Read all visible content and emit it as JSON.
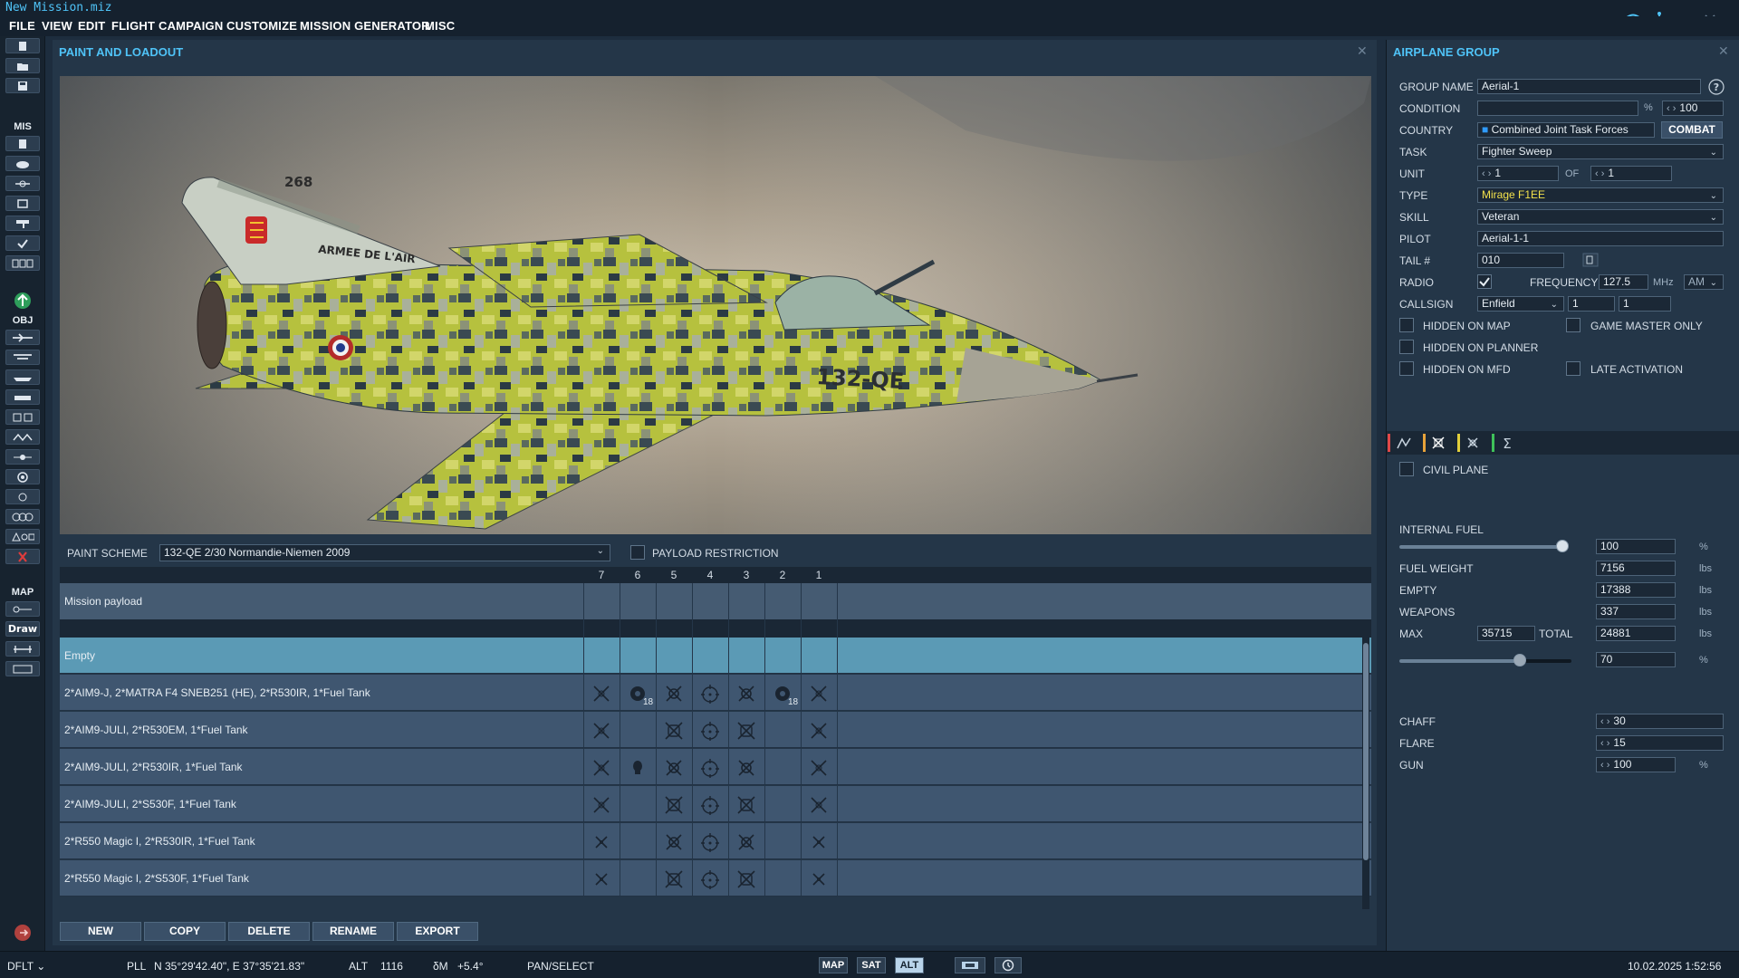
{
  "window": {
    "title": "New Mission.miz"
  },
  "menu": [
    "FILE",
    "VIEW",
    "EDIT",
    "FLIGHT",
    "CAMPAIGN",
    "CUSTOMIZE",
    "MISSION GENERATOR",
    "MISC"
  ],
  "toolbar": {
    "mis_label": "MIS",
    "obj_label": "OBJ",
    "map_label": "MAP",
    "draw_label": "Draw"
  },
  "paint": {
    "title": "PAINT AND LOADOUT",
    "aircraft_tail_text": "268",
    "aircraft_side_text": "ARMEE DE L'AIR",
    "aircraft_code": "132-QE",
    "scheme_label": "PAINT SCHEME",
    "scheme_value": "132-QE 2/30 Normandie-Niemen 2009",
    "restriction_label": "PAYLOAD RESTRICTION",
    "restriction_checked": false,
    "pylons": [
      "7",
      "6",
      "5",
      "4",
      "3",
      "2",
      "1"
    ],
    "mission_payload_label": "Mission payload",
    "rows": [
      {
        "label": "Empty",
        "selected": true,
        "cells": [
          "",
          "",
          "",
          "",
          "",
          "",
          ""
        ]
      },
      {
        "label": "2*AIM9-J, 2*MATRA F4 SNEB251 (HE), 2*R530IR, 1*Fuel Tank",
        "cells": [
          "x",
          "rocket",
          "r530",
          "tank",
          "r530",
          "rocket",
          "x"
        ],
        "rocket_count": "18"
      },
      {
        "label": "2*AIM9-JULI, 2*R530EM, 1*Fuel Tank",
        "cells": [
          "x",
          "",
          "r530em",
          "tank",
          "r530em",
          "",
          "x"
        ]
      },
      {
        "label": "2*AIM9-JULI, 2*R530IR, 1*Fuel Tank",
        "cells": [
          "x",
          "skull",
          "r530",
          "tank",
          "r530",
          "",
          "x"
        ]
      },
      {
        "label": "2*AIM9-JULI, 2*S530F, 1*Fuel Tank",
        "cells": [
          "x",
          "",
          "r530em",
          "tank",
          "r530em",
          "",
          "x"
        ]
      },
      {
        "label": "2*R550 Magic I, 2*R530IR, 1*Fuel Tank",
        "cells": [
          "xs",
          "",
          "r530",
          "tank",
          "r530",
          "",
          "xs"
        ]
      },
      {
        "label": "2*R550 Magic I, 2*S530F, 1*Fuel Tank",
        "cells": [
          "xs",
          "",
          "r530em",
          "tank",
          "r530em",
          "",
          "xs"
        ]
      }
    ],
    "buttons": [
      "NEW",
      "COPY",
      "DELETE",
      "RENAME",
      "EXPORT"
    ]
  },
  "group": {
    "title": "AIRPLANE GROUP",
    "group_name_label": "GROUP NAME",
    "group_name": "Aerial-1",
    "condition_label": "CONDITION",
    "condition_unit": "%",
    "condition_value": "100",
    "country_label": "COUNTRY",
    "country": "Combined Joint Task Forces",
    "combat_label": "COMBAT",
    "task_label": "TASK",
    "task": "Fighter Sweep",
    "unit_label": "UNIT",
    "unit_value": "1",
    "of_label": "OF",
    "of_value": "1",
    "type_label": "TYPE",
    "type": "Mirage F1EE",
    "skill_label": "SKILL",
    "skill": "Veteran",
    "pilot_label": "PILOT",
    "pilot": "Aerial-1-1",
    "tail_label": "TAIL #",
    "tail": "010",
    "radio_label": "RADIO",
    "radio_checked": true,
    "frequency_label": "FREQUENCY",
    "frequency": "127.5",
    "freq_unit": "MHz",
    "modulation": "AM",
    "callsign_label": "CALLSIGN",
    "callsign": "Enfield",
    "callsign_n1": "1",
    "callsign_n2": "1",
    "hidden_map_label": "HIDDEN ON MAP",
    "game_master_label": "GAME MASTER ONLY",
    "hidden_planner_label": "HIDDEN ON PLANNER",
    "hidden_mfd_label": "HIDDEN ON MFD",
    "late_activation_label": "LATE ACTIVATION",
    "civil_plane_label": "CIVIL PLANE",
    "internal_fuel_label": "INTERNAL FUEL",
    "internal_fuel": "100",
    "internal_fuel_unit": "%",
    "internal_fuel_fraction": 1.0,
    "fuel_weight_label": "FUEL WEIGHT",
    "fuel_weight": "7156",
    "empty_label": "EMPTY",
    "empty": "17388",
    "weapons_label": "WEAPONS",
    "weapons": "337",
    "max_label": "MAX",
    "max": "35715",
    "total_label": "TOTAL",
    "total": "24881",
    "weight_unit": "lbs",
    "total_percent": "70",
    "total_percent_unit": "%",
    "total_percent_fraction": 0.7,
    "chaff_label": "CHAFF",
    "chaff": "30",
    "flare_label": "FLARE",
    "flare": "15",
    "gun_label": "GUN",
    "gun": "100",
    "gun_unit": "%",
    "tab_colors": [
      "#e04848",
      "#e8a33a",
      "#e2cf3b",
      "#3fc25a"
    ]
  },
  "status": {
    "profile": "DFLT",
    "coord_mode": "PLL",
    "coords": "N 35°29'42.40\", E 37°35'21.83\"",
    "alt_label": "ALT",
    "alt": "1116",
    "dm_label": "δM",
    "dm": "+5.4°",
    "tool": "PAN/SELECT",
    "map_btn": "MAP",
    "sat_btn": "SAT",
    "alt_btn": "ALT",
    "datetime": "10.02.2025 1:52:56"
  }
}
